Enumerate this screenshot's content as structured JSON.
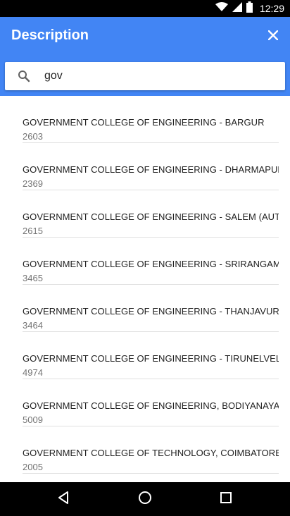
{
  "colors": {
    "app_bar": "#4285f4",
    "status_bar": "#000000",
    "nav_bar": "#000000",
    "accent": "#4285f4"
  },
  "status_bar": {
    "time": "12:29",
    "icons": [
      "wifi-icon",
      "signal-icon",
      "battery-icon"
    ]
  },
  "header": {
    "title": "Description",
    "close_icon": "close-icon"
  },
  "search": {
    "value": "gov",
    "icon": "search-icon"
  },
  "results": [
    {
      "name": "GOVERNMENT COLLEGE OF ENGINEERING - BARGUR",
      "code": "2603"
    },
    {
      "name": "GOVERNMENT COLLEGE OF ENGINEERING - DHARMAPURI",
      "code": "2369"
    },
    {
      "name": "GOVERNMENT COLLEGE OF ENGINEERING - SALEM (AUTONOMOUS)",
      "code": "2615"
    },
    {
      "name": "GOVERNMENT COLLEGE OF ENGINEERING - SRIRANGAM",
      "code": "3465"
    },
    {
      "name": "GOVERNMENT COLLEGE OF ENGINEERING - THANJAVUR",
      "code": "3464"
    },
    {
      "name": "GOVERNMENT COLLEGE OF ENGINEERING - TIRUNELVELI",
      "code": "4974"
    },
    {
      "name": "GOVERNMENT COLLEGE OF ENGINEERING, BODIYANAYAKANUR",
      "code": "5009"
    },
    {
      "name": "GOVERNMENT COLLEGE OF TECHNOLOGY, COIMBATORE",
      "code": "2005"
    }
  ],
  "nav_bar": {
    "icons": [
      "back-icon",
      "home-icon",
      "recents-icon"
    ]
  }
}
